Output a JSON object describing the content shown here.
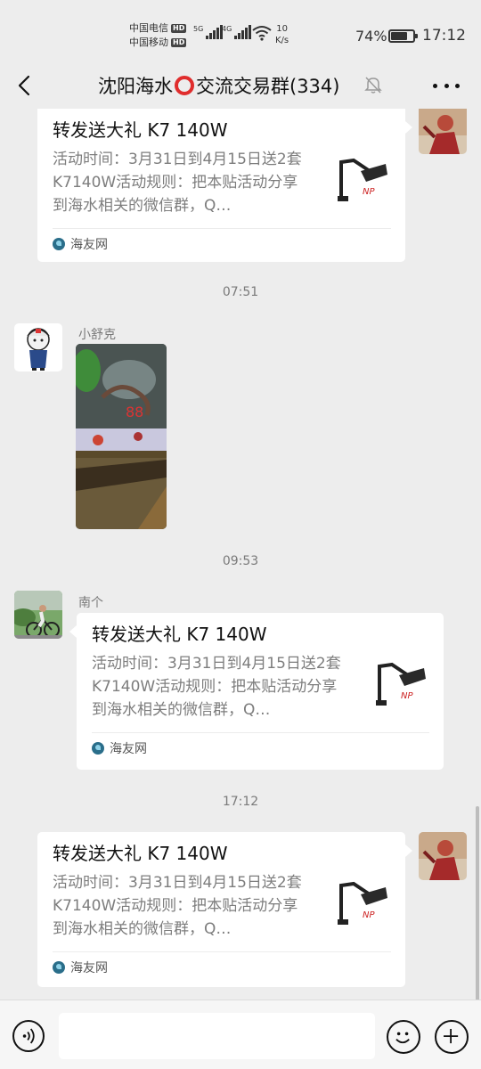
{
  "status_bar": {
    "carrier1": "中国电信",
    "carrier2": "中国移动",
    "hd": "HD",
    "net1": "5G",
    "net2": "4G",
    "speed_value": "10",
    "speed_unit": "K/s",
    "battery_percent": "74%",
    "battery_level": 0.74,
    "time": "17:12"
  },
  "header": {
    "title_before": "沈阳海水",
    "title_after": "交流交易群(334)"
  },
  "messages": [
    {
      "type": "link-card",
      "side": "right",
      "title": "转发送大礼 K7 140W",
      "description": "活动时间：3月31日到4月15日送2套K7140W活动规则：把本贴活动分享到海水相关的微信群，Q…",
      "source": "海友网"
    },
    {
      "type": "timestamp",
      "text": "07:51"
    },
    {
      "type": "image",
      "side": "left",
      "sender": "小舒克"
    },
    {
      "type": "timestamp",
      "text": "09:53"
    },
    {
      "type": "link-card",
      "side": "left",
      "sender": "南个",
      "title": "转发送大礼 K7 140W",
      "description": "活动时间：3月31日到4月15日送2套K7140W活动规则：把本贴活动分享到海水相关的微信群，Q…",
      "source": "海友网"
    },
    {
      "type": "timestamp",
      "text": "17:12"
    },
    {
      "type": "link-card",
      "side": "right",
      "title": "转发送大礼 K7 140W",
      "description": "活动时间：3月31日到4月15日送2套K7140W活动规则：把本贴活动分享到海水相关的微信群，Q…",
      "source": "海友网"
    }
  ],
  "input_bar": {
    "placeholder": ""
  },
  "icons": {
    "back": "chevron-left-icon",
    "mute": "bell-off-icon",
    "more": "more-dots-icon",
    "voice": "voice-icon",
    "emoji": "emoji-icon",
    "plus": "plus-icon"
  },
  "colors": {
    "background": "#ededed",
    "bubble": "#ffffff",
    "ring_emoji": "#e02d2d",
    "muted_text": "#7a7a7a"
  }
}
